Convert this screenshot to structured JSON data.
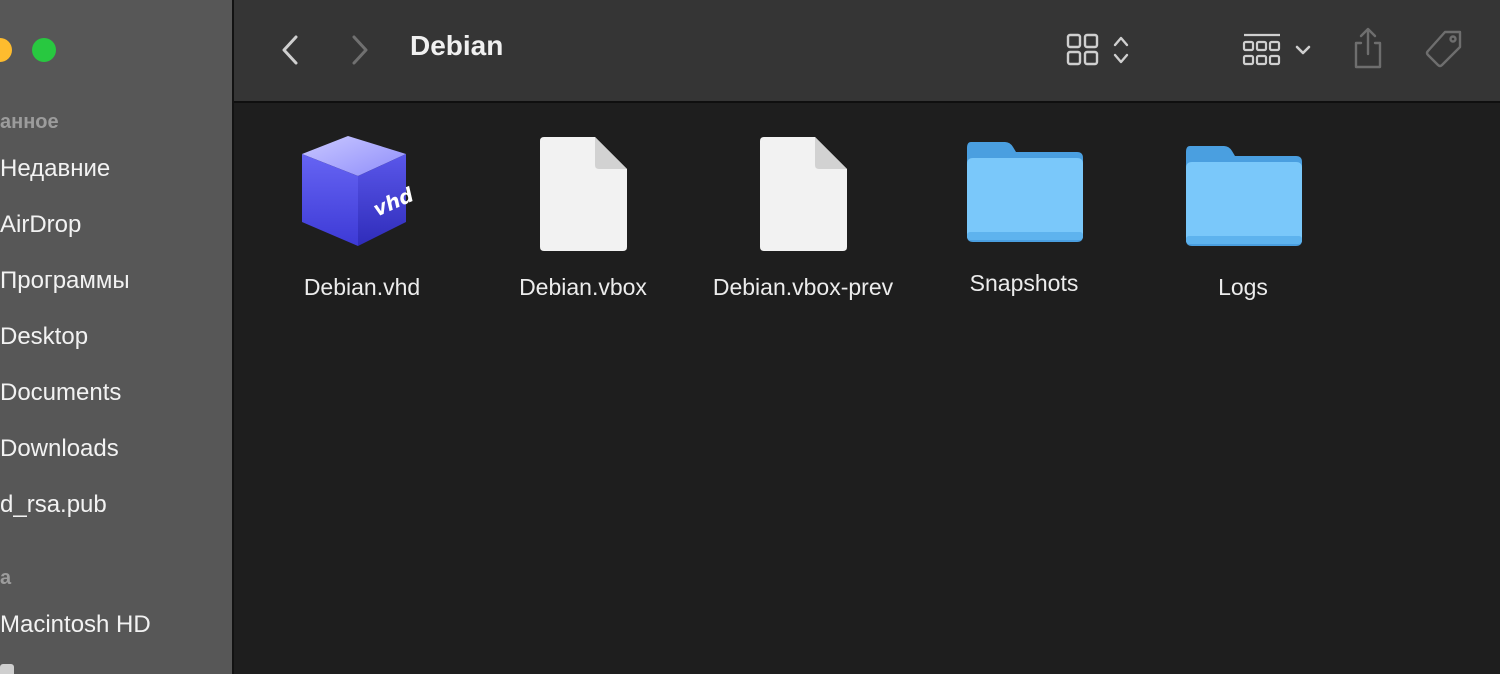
{
  "window": {
    "title": "Debian"
  },
  "sidebar": {
    "favorites_header": "анное",
    "favorites": [
      {
        "label": "Недавние",
        "icon": "clock-icon"
      },
      {
        "label": "AirDrop",
        "icon": "airdrop-icon"
      },
      {
        "label": "Программы",
        "icon": "applications-icon"
      },
      {
        "label": "Desktop",
        "icon": "desktop-icon"
      },
      {
        "label": "Documents",
        "icon": "document-icon"
      },
      {
        "label": "Downloads",
        "icon": "downloads-icon"
      },
      {
        "label": "d_rsa.pub",
        "icon": "file-icon"
      }
    ],
    "locations_header": "а",
    "locations": [
      {
        "label": "Macintosh HD",
        "icon": "disk-icon"
      }
    ]
  },
  "toolbar": {
    "back": "chevron-left-icon",
    "forward": "chevron-right-icon",
    "view_mode": "icon-grid-icon",
    "group": "group-grid-icon",
    "share": "share-icon",
    "tags": "tag-icon"
  },
  "files": [
    {
      "name": "Debian.vhd",
      "kind": "vhd-disk-image",
      "icon": "vhd-cube-icon"
    },
    {
      "name": "Debian.vbox",
      "kind": "document",
      "icon": "document-icon"
    },
    {
      "name": "Debian.vbox-prev",
      "kind": "document",
      "icon": "document-icon"
    },
    {
      "name": "Snapshots",
      "kind": "folder",
      "icon": "folder-icon"
    },
    {
      "name": "Logs",
      "kind": "folder",
      "icon": "folder-icon"
    }
  ],
  "colors": {
    "sidebar": "#575757",
    "toolbar": "#353535",
    "content": "#1e1e1e",
    "folder": "#7cc5f8",
    "vhd_cube": "#5b5af0"
  }
}
